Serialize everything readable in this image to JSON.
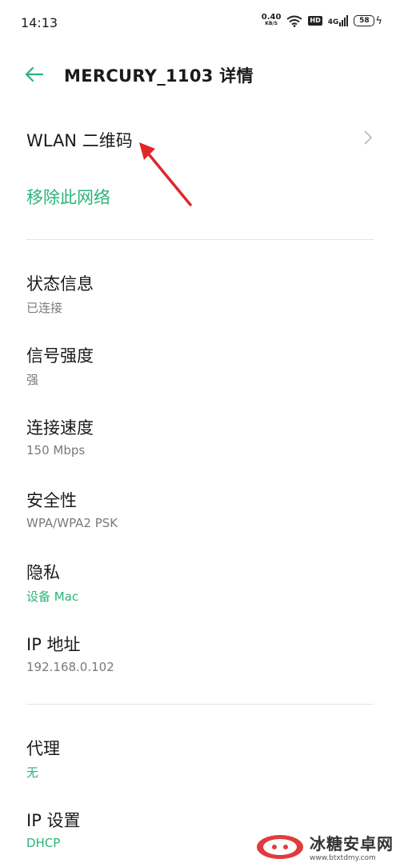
{
  "status_bar": {
    "time": "14:13",
    "speed_value": "0.40",
    "speed_unit": "KB/S",
    "hd_label": "HD",
    "network_label": "4G",
    "battery_level": "58"
  },
  "header": {
    "title": "MERCURY_1103 详情"
  },
  "actions": {
    "qr_label": "WLAN 二维码",
    "remove_label": "移除此网络"
  },
  "details": [
    {
      "label": "状态信息",
      "value": "已连接"
    },
    {
      "label": "信号强度",
      "value": "强"
    },
    {
      "label": "连接速度",
      "value": "150 Mbps"
    },
    {
      "label": "安全性",
      "value": "WPA/WPA2 PSK"
    },
    {
      "label": "隐私",
      "value": "设备 Mac"
    },
    {
      "label": "IP 地址",
      "value": "192.168.0.102"
    }
  ],
  "advanced": [
    {
      "label": "代理",
      "value": "无"
    },
    {
      "label": "IP 设置",
      "value": "DHCP"
    }
  ],
  "watermark": {
    "name": "冰糖安卓网",
    "url": "www.btxtdmy.com"
  },
  "colors": {
    "accent": "#2bb37a",
    "annotation_arrow": "#e0262b"
  }
}
